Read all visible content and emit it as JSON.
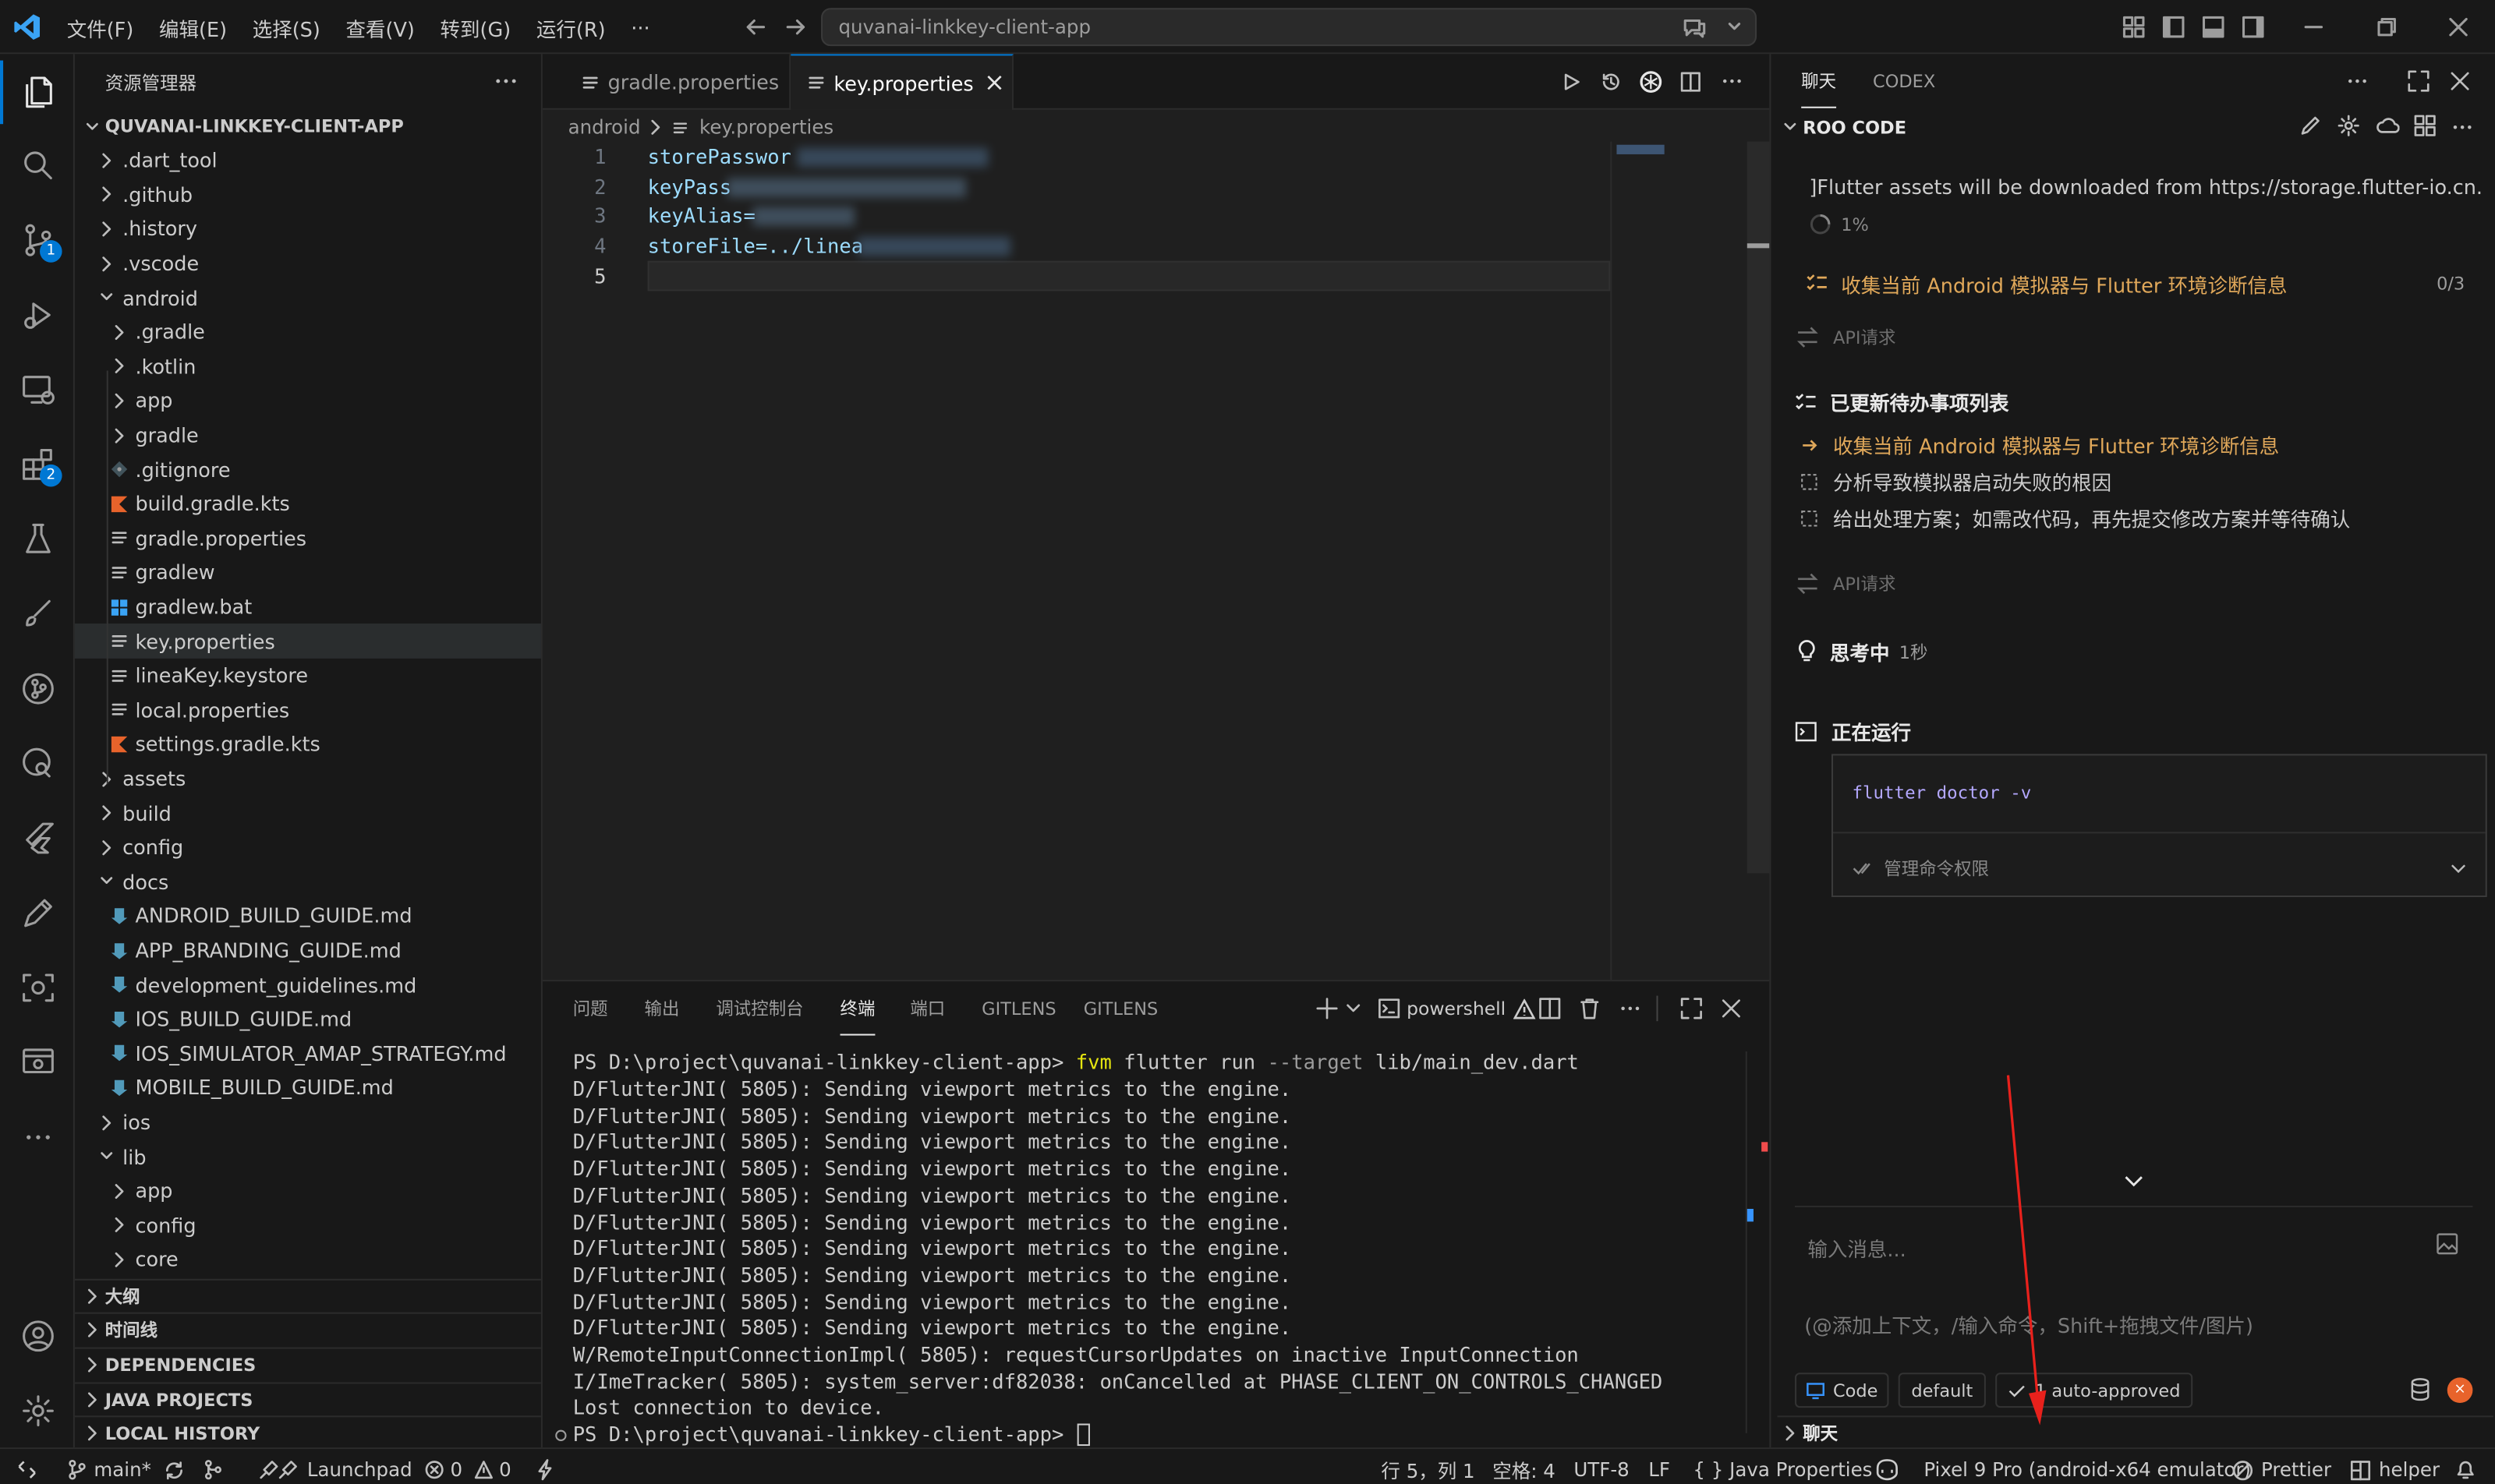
{
  "titlebar": {
    "menus": [
      "文件(F)",
      "编辑(E)",
      "选择(S)",
      "查看(V)",
      "转到(G)",
      "运行(R)",
      "···"
    ],
    "search": "quvanai-linkkey-client-app"
  },
  "activity": {
    "badge_scm": "1",
    "badge_ext": "2"
  },
  "explorer": {
    "title": "资源管理器",
    "root": "QUVANAI-LINKKEY-CLIENT-APP",
    "items": [
      {
        "label": ".dart_tool",
        "depth": 1,
        "kind": "folder",
        "open": false
      },
      {
        "label": ".github",
        "depth": 1,
        "kind": "folder",
        "open": false
      },
      {
        "label": ".history",
        "depth": 1,
        "kind": "folder",
        "open": false
      },
      {
        "label": ".vscode",
        "depth": 1,
        "kind": "folder",
        "open": false
      },
      {
        "label": "android",
        "depth": 1,
        "kind": "folder",
        "open": true
      },
      {
        "label": ".gradle",
        "depth": 2,
        "kind": "folder",
        "open": false
      },
      {
        "label": ".kotlin",
        "depth": 2,
        "kind": "folder",
        "open": false
      },
      {
        "label": "app",
        "depth": 2,
        "kind": "folder",
        "open": false
      },
      {
        "label": "gradle",
        "depth": 2,
        "kind": "folder",
        "open": false
      },
      {
        "label": ".gitignore",
        "depth": 2,
        "kind": "git"
      },
      {
        "label": "build.gradle.kts",
        "depth": 2,
        "kind": "kotlin"
      },
      {
        "label": "gradle.properties",
        "depth": 2,
        "kind": "lines"
      },
      {
        "label": "gradlew",
        "depth": 2,
        "kind": "lines"
      },
      {
        "label": "gradlew.bat",
        "depth": 2,
        "kind": "windows"
      },
      {
        "label": "key.properties",
        "depth": 2,
        "kind": "lines",
        "selected": true
      },
      {
        "label": "lineaKey.keystore",
        "depth": 2,
        "kind": "lines"
      },
      {
        "label": "local.properties",
        "depth": 2,
        "kind": "lines"
      },
      {
        "label": "settings.gradle.kts",
        "depth": 2,
        "kind": "kotlin"
      },
      {
        "label": "assets",
        "depth": 1,
        "kind": "folder",
        "open": false
      },
      {
        "label": "build",
        "depth": 1,
        "kind": "folder",
        "open": false
      },
      {
        "label": "config",
        "depth": 1,
        "kind": "folder",
        "open": false
      },
      {
        "label": "docs",
        "depth": 1,
        "kind": "folder",
        "open": true
      },
      {
        "label": "ANDROID_BUILD_GUIDE.md",
        "depth": 2,
        "kind": "md"
      },
      {
        "label": "APP_BRANDING_GUIDE.md",
        "depth": 2,
        "kind": "md"
      },
      {
        "label": "development_guidelines.md",
        "depth": 2,
        "kind": "md"
      },
      {
        "label": "IOS_BUILD_GUIDE.md",
        "depth": 2,
        "kind": "md"
      },
      {
        "label": "IOS_SIMULATOR_AMAP_STRATEGY.md",
        "depth": 2,
        "kind": "md"
      },
      {
        "label": "MOBILE_BUILD_GUIDE.md",
        "depth": 2,
        "kind": "md"
      },
      {
        "label": "ios",
        "depth": 1,
        "kind": "folder",
        "open": false
      },
      {
        "label": "lib",
        "depth": 1,
        "kind": "folder",
        "open": true
      },
      {
        "label": "app",
        "depth": 2,
        "kind": "folder",
        "open": false
      },
      {
        "label": "config",
        "depth": 2,
        "kind": "folder",
        "open": false
      },
      {
        "label": "core",
        "depth": 2,
        "kind": "folder",
        "open": false
      }
    ],
    "sections": [
      "大纲",
      "时间线",
      "DEPENDENCIES",
      "JAVA PROJECTS",
      "LOCAL HISTORY"
    ]
  },
  "editor": {
    "tabs": [
      "gradle.properties",
      "key.properties"
    ],
    "breadcrumb": [
      "android",
      "key.properties"
    ],
    "lines": [
      {
        "n": "1",
        "text": "storePasswor"
      },
      {
        "n": "2",
        "text": "keyPass"
      },
      {
        "n": "3",
        "text": "keyAlias="
      },
      {
        "n": "4",
        "text": "storeFile=../linea"
      },
      {
        "n": "5",
        "text": ""
      }
    ]
  },
  "panel": {
    "tabs": [
      "问题",
      "输出",
      "调试控制台",
      "终端",
      "端口",
      "GITLENS",
      "GITLENS"
    ],
    "shell": "powershell",
    "prompt": "PS D:\\project\\quvanai-linkkey-client-app>",
    "cmd_fvm": "fvm",
    "cmd_flutter": "flutter run",
    "cmd_flag": "--target",
    "cmd_arg": "lib/main_dev.dart",
    "lines": [
      "D/FlutterJNI( 5805): Sending viewport metrics to the engine.",
      "D/FlutterJNI( 5805): Sending viewport metrics to the engine.",
      "D/FlutterJNI( 5805): Sending viewport metrics to the engine.",
      "D/FlutterJNI( 5805): Sending viewport metrics to the engine.",
      "D/FlutterJNI( 5805): Sending viewport metrics to the engine.",
      "D/FlutterJNI( 5805): Sending viewport metrics to the engine.",
      "D/FlutterJNI( 5805): Sending viewport metrics to the engine.",
      "D/FlutterJNI( 5805): Sending viewport metrics to the engine.",
      "D/FlutterJNI( 5805): Sending viewport metrics to the engine.",
      "D/FlutterJNI( 5805): Sending viewport metrics to the engine.",
      "W/RemoteInputConnectionImpl( 5805): requestCursorUpdates on inactive InputConnection",
      "I/ImeTracker( 5805): system_server:df82038: onCancelled at PHASE_CLIENT_ON_CONTROLS_CHANGED",
      "Lost connection to device."
    ],
    "final_prompt": "PS D:\\project\\quvanai-linkkey-client-app>"
  },
  "chat": {
    "tabs": [
      "聊天",
      "CODEX"
    ],
    "header": "ROO CODE",
    "flutter_msg": "]Flutter assets will be downloaded from https://storage.flutter-io.cn.",
    "progress": "1%",
    "task_title": "收集当前 Android 模拟器与 Flutter 环境诊断信息",
    "task_count": "0/3",
    "api_request": "API请求",
    "todo_title": "已更新待办事项列表",
    "todos": [
      {
        "text": "收集当前 Android 模拟器与 Flutter 环境诊断信息",
        "state": "active"
      },
      {
        "text": "分析导致模拟器启动失败的根因",
        "state": "pending"
      },
      {
        "text": "给出处理方案；如需改代码，再先提交修改方案并等待确认",
        "state": "pending"
      }
    ],
    "api_request_2": "API请求",
    "thinking": "思考中",
    "thinking_time": "1秒",
    "running": "正在运行",
    "command": "flutter doctor -v",
    "perm": "管理命令权限",
    "input_placeholder": "输入消息...",
    "hint": "(@添加上下文，/输入命令，Shift+拖拽文件/图片)",
    "mode": "Code",
    "profile": "default",
    "auto": "1 auto-approved",
    "footer": "聊天"
  },
  "status": {
    "branch": "main*",
    "launchpad": "Launchpad",
    "errors": "0",
    "warnings": "0",
    "position": "行 5，列 1",
    "spaces": "空格: 4",
    "encoding": "UTF-8",
    "eol": "LF",
    "language": "{ } Java Properties",
    "device": "Pixel 9 Pro (android-x64 emulator)",
    "prettier": "Prettier",
    "helper": "helper"
  },
  "colors": {
    "accent": "#0078d4",
    "todo_active": "#e0a85a",
    "kotlin": "#e8632b",
    "md": "#519aba"
  }
}
